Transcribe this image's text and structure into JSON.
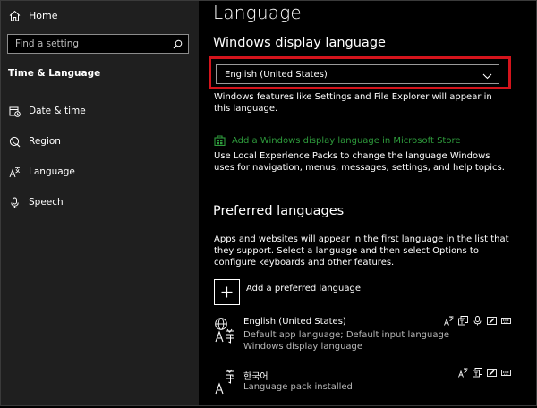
{
  "sidebar": {
    "home_label": "Home",
    "search_placeholder": "Find a setting",
    "section_title": "Time & Language",
    "items": [
      {
        "label": "Date & time",
        "icon": "calendar-clock-icon"
      },
      {
        "label": "Region",
        "icon": "globe-icon"
      },
      {
        "label": "Language",
        "icon": "language-icon"
      },
      {
        "label": "Speech",
        "icon": "microphone-icon"
      }
    ]
  },
  "main": {
    "title": "Language",
    "display_language": {
      "heading": "Windows display language",
      "selected": "English (United States)",
      "description": "Windows features like Settings and File Explorer will appear in this language.",
      "store_link": "Add a Windows display language in Microsoft Store",
      "store_description": "Use Local Experience Packs to change the language Windows uses for navigation, menus, messages, settings, and help topics."
    },
    "preferred": {
      "heading": "Preferred languages",
      "description": "Apps and websites will appear in the first language in the list that they support. Select a language and then select Options to configure keyboards and other features.",
      "add_label": "Add a preferred language",
      "languages": [
        {
          "name": "English (United States)",
          "sub_line1": "Default app language; Default input language",
          "sub_line2": "Windows display language"
        },
        {
          "name": "한국어",
          "sub_line1": "Language pack installed",
          "sub_line2": ""
        }
      ]
    }
  },
  "colors": {
    "sidebar_bg": "#1f1f1f",
    "accent_link": "#2e9b3c",
    "highlight_box": "#d4141c"
  }
}
